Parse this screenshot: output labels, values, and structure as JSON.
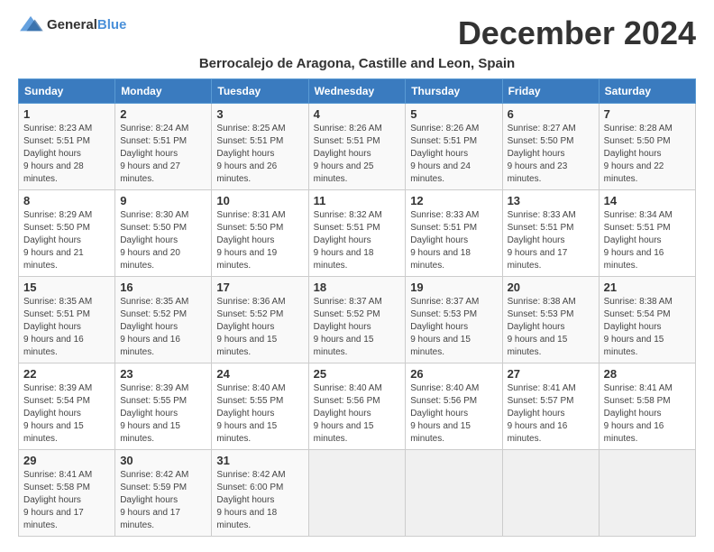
{
  "header": {
    "logo_general": "General",
    "logo_blue": "Blue",
    "month_year": "December 2024",
    "location": "Berrocalejo de Aragona, Castille and Leon, Spain"
  },
  "days_of_week": [
    "Sunday",
    "Monday",
    "Tuesday",
    "Wednesday",
    "Thursday",
    "Friday",
    "Saturday"
  ],
  "weeks": [
    [
      {
        "day": "1",
        "sunrise": "8:23 AM",
        "sunset": "5:51 PM",
        "daylight": "9 hours and 28 minutes."
      },
      {
        "day": "2",
        "sunrise": "8:24 AM",
        "sunset": "5:51 PM",
        "daylight": "9 hours and 27 minutes."
      },
      {
        "day": "3",
        "sunrise": "8:25 AM",
        "sunset": "5:51 PM",
        "daylight": "9 hours and 26 minutes."
      },
      {
        "day": "4",
        "sunrise": "8:26 AM",
        "sunset": "5:51 PM",
        "daylight": "9 hours and 25 minutes."
      },
      {
        "day": "5",
        "sunrise": "8:26 AM",
        "sunset": "5:51 PM",
        "daylight": "9 hours and 24 minutes."
      },
      {
        "day": "6",
        "sunrise": "8:27 AM",
        "sunset": "5:50 PM",
        "daylight": "9 hours and 23 minutes."
      },
      {
        "day": "7",
        "sunrise": "8:28 AM",
        "sunset": "5:50 PM",
        "daylight": "9 hours and 22 minutes."
      }
    ],
    [
      {
        "day": "8",
        "sunrise": "8:29 AM",
        "sunset": "5:50 PM",
        "daylight": "9 hours and 21 minutes."
      },
      {
        "day": "9",
        "sunrise": "8:30 AM",
        "sunset": "5:50 PM",
        "daylight": "9 hours and 20 minutes."
      },
      {
        "day": "10",
        "sunrise": "8:31 AM",
        "sunset": "5:50 PM",
        "daylight": "9 hours and 19 minutes."
      },
      {
        "day": "11",
        "sunrise": "8:32 AM",
        "sunset": "5:51 PM",
        "daylight": "9 hours and 18 minutes."
      },
      {
        "day": "12",
        "sunrise": "8:33 AM",
        "sunset": "5:51 PM",
        "daylight": "9 hours and 18 minutes."
      },
      {
        "day": "13",
        "sunrise": "8:33 AM",
        "sunset": "5:51 PM",
        "daylight": "9 hours and 17 minutes."
      },
      {
        "day": "14",
        "sunrise": "8:34 AM",
        "sunset": "5:51 PM",
        "daylight": "9 hours and 16 minutes."
      }
    ],
    [
      {
        "day": "15",
        "sunrise": "8:35 AM",
        "sunset": "5:51 PM",
        "daylight": "9 hours and 16 minutes."
      },
      {
        "day": "16",
        "sunrise": "8:35 AM",
        "sunset": "5:52 PM",
        "daylight": "9 hours and 16 minutes."
      },
      {
        "day": "17",
        "sunrise": "8:36 AM",
        "sunset": "5:52 PM",
        "daylight": "9 hours and 15 minutes."
      },
      {
        "day": "18",
        "sunrise": "8:37 AM",
        "sunset": "5:52 PM",
        "daylight": "9 hours and 15 minutes."
      },
      {
        "day": "19",
        "sunrise": "8:37 AM",
        "sunset": "5:53 PM",
        "daylight": "9 hours and 15 minutes."
      },
      {
        "day": "20",
        "sunrise": "8:38 AM",
        "sunset": "5:53 PM",
        "daylight": "9 hours and 15 minutes."
      },
      {
        "day": "21",
        "sunrise": "8:38 AM",
        "sunset": "5:54 PM",
        "daylight": "9 hours and 15 minutes."
      }
    ],
    [
      {
        "day": "22",
        "sunrise": "8:39 AM",
        "sunset": "5:54 PM",
        "daylight": "9 hours and 15 minutes."
      },
      {
        "day": "23",
        "sunrise": "8:39 AM",
        "sunset": "5:55 PM",
        "daylight": "9 hours and 15 minutes."
      },
      {
        "day": "24",
        "sunrise": "8:40 AM",
        "sunset": "5:55 PM",
        "daylight": "9 hours and 15 minutes."
      },
      {
        "day": "25",
        "sunrise": "8:40 AM",
        "sunset": "5:56 PM",
        "daylight": "9 hours and 15 minutes."
      },
      {
        "day": "26",
        "sunrise": "8:40 AM",
        "sunset": "5:56 PM",
        "daylight": "9 hours and 15 minutes."
      },
      {
        "day": "27",
        "sunrise": "8:41 AM",
        "sunset": "5:57 PM",
        "daylight": "9 hours and 16 minutes."
      },
      {
        "day": "28",
        "sunrise": "8:41 AM",
        "sunset": "5:58 PM",
        "daylight": "9 hours and 16 minutes."
      }
    ],
    [
      {
        "day": "29",
        "sunrise": "8:41 AM",
        "sunset": "5:58 PM",
        "daylight": "9 hours and 17 minutes."
      },
      {
        "day": "30",
        "sunrise": "8:42 AM",
        "sunset": "5:59 PM",
        "daylight": "9 hours and 17 minutes."
      },
      {
        "day": "31",
        "sunrise": "8:42 AM",
        "sunset": "6:00 PM",
        "daylight": "9 hours and 18 minutes."
      },
      null,
      null,
      null,
      null
    ]
  ],
  "labels": {
    "sunrise": "Sunrise:",
    "sunset": "Sunset:",
    "daylight": "Daylight hours"
  }
}
